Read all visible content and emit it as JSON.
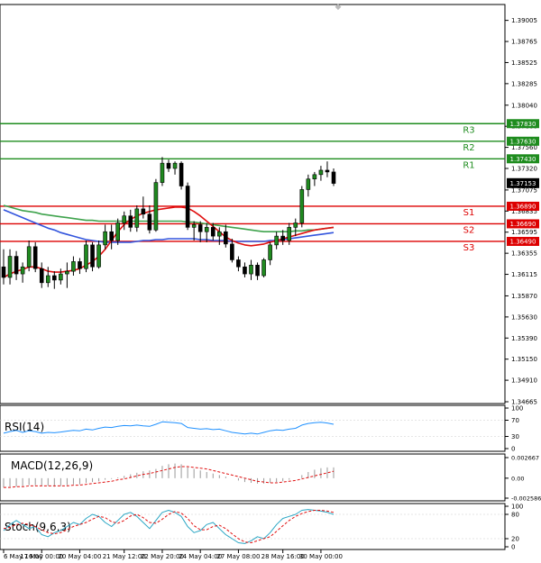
{
  "chart_data": {
    "type": "candlestick",
    "main": {
      "ylim": [
        1.34665,
        1.39155
      ],
      "price_axis_labels": [
        "1.39005",
        "1.38765",
        "1.38525",
        "1.38285",
        "1.38040",
        "1.37800",
        "1.37560",
        "1.37320",
        "1.37075",
        "1.36835",
        "1.36595",
        "1.36355",
        "1.36115",
        "1.35870",
        "1.35630",
        "1.35390",
        "1.35150",
        "1.34910",
        "1.34665"
      ],
      "levels": [
        {
          "name": "R3",
          "value": 1.3783,
          "label": "1.37830",
          "color": "#1e8c1e"
        },
        {
          "name": "R2",
          "value": 1.3763,
          "label": "1.37630",
          "color": "#1e8c1e"
        },
        {
          "name": "R1",
          "value": 1.3743,
          "label": "1.37430",
          "color": "#1e8c1e"
        },
        {
          "name": "S1",
          "value": 1.3689,
          "label": "1.36890",
          "color": "#dd0000"
        },
        {
          "name": "S2",
          "value": 1.3669,
          "label": "1.36690",
          "color": "#dd0000"
        },
        {
          "name": "S3",
          "value": 1.3649,
          "label": "1.36490",
          "color": "#dd0000"
        }
      ],
      "current_price": {
        "value": 1.37153,
        "label": "1.37153"
      },
      "candles": [
        [
          1.362,
          1.364,
          1.36,
          1.3608
        ],
        [
          1.3608,
          1.364,
          1.36,
          1.3632
        ],
        [
          1.3632,
          1.3638,
          1.3605,
          1.3612
        ],
        [
          1.3612,
          1.3625,
          1.3602,
          1.362
        ],
        [
          1.362,
          1.365,
          1.3615,
          1.3643
        ],
        [
          1.3643,
          1.3648,
          1.3614,
          1.3618
        ],
        [
          1.3618,
          1.3625,
          1.3596,
          1.3602
        ],
        [
          1.3602,
          1.362,
          1.3597,
          1.361
        ],
        [
          1.361,
          1.3615,
          1.3595,
          1.3605
        ],
        [
          1.3605,
          1.3618,
          1.36,
          1.3612
        ],
        [
          1.3612,
          1.3625,
          1.3596,
          1.3615
        ],
        [
          1.3615,
          1.3632,
          1.361,
          1.3626
        ],
        [
          1.3626,
          1.363,
          1.3612,
          1.3618
        ],
        [
          1.3618,
          1.365,
          1.3614,
          1.3645
        ],
        [
          1.3645,
          1.3648,
          1.3615,
          1.362
        ],
        [
          1.362,
          1.365,
          1.3618,
          1.3645
        ],
        [
          1.3645,
          1.3668,
          1.364,
          1.366
        ],
        [
          1.366,
          1.3668,
          1.364,
          1.365
        ],
        [
          1.365,
          1.3675,
          1.3645,
          1.367
        ],
        [
          1.367,
          1.3683,
          1.3662,
          1.3678
        ],
        [
          1.3678,
          1.3685,
          1.366,
          1.3665
        ],
        [
          1.3665,
          1.369,
          1.366,
          1.3686
        ],
        [
          1.3686,
          1.37,
          1.3675,
          1.368
        ],
        [
          1.368,
          1.369,
          1.3658,
          1.3662
        ],
        [
          1.3662,
          1.372,
          1.366,
          1.3716
        ],
        [
          1.3716,
          1.3745,
          1.3712,
          1.3738
        ],
        [
          1.3738,
          1.3742,
          1.3728,
          1.3732
        ],
        [
          1.3732,
          1.374,
          1.3725,
          1.3738
        ],
        [
          1.3738,
          1.374,
          1.3708,
          1.3712
        ],
        [
          1.3712,
          1.3716,
          1.3662,
          1.3665
        ],
        [
          1.3665,
          1.3672,
          1.365,
          1.3668
        ],
        [
          1.3668,
          1.3672,
          1.3648,
          1.366
        ],
        [
          1.366,
          1.367,
          1.3648,
          1.3665
        ],
        [
          1.3665,
          1.367,
          1.365,
          1.3655
        ],
        [
          1.3655,
          1.3665,
          1.3645,
          1.366
        ],
        [
          1.366,
          1.3668,
          1.3642,
          1.3646
        ],
        [
          1.3646,
          1.3652,
          1.3625,
          1.3628
        ],
        [
          1.3628,
          1.3632,
          1.3615,
          1.362
        ],
        [
          1.362,
          1.3625,
          1.3608,
          1.3612
        ],
        [
          1.3612,
          1.3628,
          1.3605,
          1.3622
        ],
        [
          1.3622,
          1.3625,
          1.3605,
          1.361
        ],
        [
          1.361,
          1.363,
          1.3608,
          1.3628
        ],
        [
          1.3628,
          1.3648,
          1.3622,
          1.3645
        ],
        [
          1.3645,
          1.366,
          1.364,
          1.3655
        ],
        [
          1.3655,
          1.3662,
          1.3645,
          1.365
        ],
        [
          1.365,
          1.367,
          1.3645,
          1.3665
        ],
        [
          1.3665,
          1.3675,
          1.3655,
          1.367
        ],
        [
          1.367,
          1.3712,
          1.3665,
          1.3708
        ],
        [
          1.3708,
          1.3725,
          1.37,
          1.372
        ],
        [
          1.372,
          1.3728,
          1.3712,
          1.3725
        ],
        [
          1.3725,
          1.3735,
          1.3718,
          1.373
        ],
        [
          1.373,
          1.374,
          1.3722,
          1.3728
        ],
        [
          1.3728,
          1.3732,
          1.3712,
          1.3715
        ]
      ],
      "ma_red": [
        1.3608,
        1.3612,
        1.3615,
        1.3617,
        1.362,
        1.362,
        1.3618,
        1.3615,
        1.3614,
        1.3614,
        1.3615,
        1.3616,
        1.3618,
        1.3622,
        1.3626,
        1.3632,
        1.364,
        1.365,
        1.366,
        1.3668,
        1.3674,
        1.3678,
        1.3681,
        1.3683,
        1.3685,
        1.3686,
        1.3687,
        1.3688,
        1.3688,
        1.3687,
        1.3683,
        1.3678,
        1.3672,
        1.3666,
        1.366,
        1.3654,
        1.365,
        1.3647,
        1.3645,
        1.3644,
        1.3645,
        1.3646,
        1.3648,
        1.365,
        1.3652,
        1.3654,
        1.3656,
        1.3658,
        1.366,
        1.3662,
        1.3663,
        1.3664,
        1.3665
      ],
      "ma_blue": [
        1.3685,
        1.3682,
        1.3679,
        1.3676,
        1.3673,
        1.367,
        1.3667,
        1.3664,
        1.3662,
        1.3659,
        1.3657,
        1.3655,
        1.3653,
        1.3651,
        1.365,
        1.3649,
        1.3648,
        1.3648,
        1.3648,
        1.3648,
        1.3648,
        1.3649,
        1.365,
        1.365,
        1.3651,
        1.3651,
        1.3652,
        1.3652,
        1.3652,
        1.3652,
        1.3652,
        1.3651,
        1.3651,
        1.365,
        1.365,
        1.365,
        1.3649,
        1.3649,
        1.3649,
        1.3649,
        1.3649,
        1.3649,
        1.365,
        1.365,
        1.3651,
        1.3652,
        1.3653,
        1.3654,
        1.3655,
        1.3656,
        1.3657,
        1.3658,
        1.3659
      ],
      "ma_green": [
        1.369,
        1.3688,
        1.3686,
        1.3684,
        1.3683,
        1.3682,
        1.368,
        1.3679,
        1.3678,
        1.3677,
        1.3676,
        1.3675,
        1.3674,
        1.3673,
        1.3673,
        1.3672,
        1.3672,
        1.3672,
        1.3672,
        1.3672,
        1.3672,
        1.3672,
        1.3672,
        1.3672,
        1.3672,
        1.3672,
        1.3672,
        1.3672,
        1.3672,
        1.3671,
        1.3671,
        1.367,
        1.3669,
        1.3668,
        1.3667,
        1.3666,
        1.3665,
        1.3664,
        1.3663,
        1.3662,
        1.3661,
        1.366,
        1.366,
        1.366,
        1.366,
        1.366,
        1.3661,
        1.3661,
        1.3662,
        1.3662,
        1.3663,
        1.3664,
        1.3665
      ]
    },
    "rsi": {
      "label": "RSI(14)",
      "ylim": [
        0,
        100
      ],
      "axis_labels": [
        "100",
        "70",
        "30",
        "0"
      ],
      "axis_values": [
        100,
        70,
        30,
        0
      ],
      "values": [
        38,
        42,
        45,
        40,
        44,
        42,
        38,
        40,
        39,
        41,
        43,
        45,
        44,
        48,
        46,
        50,
        53,
        52,
        55,
        57,
        56,
        58,
        56,
        55,
        60,
        66,
        65,
        64,
        62,
        52,
        50,
        48,
        49,
        47,
        48,
        44,
        40,
        38,
        36,
        38,
        36,
        40,
        44,
        46,
        45,
        48,
        50,
        58,
        62,
        64,
        65,
        63,
        60
      ]
    },
    "macd": {
      "label": "MACD(12,26,9)",
      "ylim": [
        -0.002586,
        0.002667
      ],
      "axis_labels": [
        "0.002667",
        "0.00",
        "-0.002586"
      ],
      "axis_values": [
        0.002667,
        0,
        -0.002586
      ],
      "hist": [
        -0.0012,
        -0.0011,
        -0.0011,
        -0.001,
        -0.0009,
        -0.0009,
        -0.001,
        -0.001,
        -0.0011,
        -0.001,
        -0.0009,
        -0.0008,
        -0.0008,
        -0.0006,
        -0.0005,
        -0.0004,
        -0.0002,
        -0.0001,
        0.0001,
        0.0003,
        0.0005,
        0.0007,
        0.0009,
        0.001,
        0.0012,
        0.0016,
        0.0018,
        0.0019,
        0.0018,
        0.0014,
        0.0012,
        0.001,
        0.0008,
        0.0006,
        0.0004,
        0.0002,
        0.0,
        -0.0003,
        -0.0005,
        -0.0006,
        -0.0007,
        -0.0007,
        -0.0006,
        -0.0005,
        -0.0004,
        -0.0002,
        0.0,
        0.0004,
        0.0008,
        0.0011,
        0.0013,
        0.0014,
        0.0014
      ],
      "signal": [
        -0.0012,
        -0.0012,
        -0.0011,
        -0.0011,
        -0.001,
        -0.001,
        -0.001,
        -0.001,
        -0.001,
        -0.001,
        -0.001,
        -0.0009,
        -0.0009,
        -0.0008,
        -0.0007,
        -0.0006,
        -0.0005,
        -0.0004,
        -0.0002,
        -0.0001,
        0.0001,
        0.0003,
        0.0005,
        0.0006,
        0.0008,
        0.001,
        0.0012,
        0.0014,
        0.0015,
        0.0015,
        0.0014,
        0.0013,
        0.0012,
        0.001,
        0.0008,
        0.0006,
        0.0004,
        0.0002,
        0.0,
        -0.0002,
        -0.0004,
        -0.0005,
        -0.0006,
        -0.0006,
        -0.0005,
        -0.0004,
        -0.0003,
        -0.0001,
        0.0001,
        0.0003,
        0.0005,
        0.0007,
        0.0009
      ]
    },
    "stoch": {
      "label": "Stoch(9,6,3)",
      "ylim": [
        0,
        100
      ],
      "axis_labels": [
        "100",
        "80",
        "20",
        "0"
      ],
      "axis_values": [
        100,
        80,
        20,
        0
      ],
      "k": [
        40,
        55,
        65,
        55,
        45,
        50,
        30,
        25,
        35,
        40,
        50,
        60,
        55,
        70,
        80,
        75,
        60,
        50,
        65,
        80,
        85,
        75,
        60,
        45,
        65,
        85,
        90,
        85,
        75,
        50,
        35,
        40,
        55,
        60,
        45,
        30,
        20,
        10,
        8,
        15,
        25,
        20,
        35,
        55,
        70,
        75,
        80,
        90,
        92,
        90,
        88,
        85,
        80
      ],
      "d": [
        45,
        48,
        55,
        58,
        55,
        50,
        42,
        35,
        32,
        35,
        42,
        50,
        55,
        60,
        68,
        75,
        72,
        62,
        58,
        65,
        76,
        80,
        72,
        60,
        58,
        68,
        80,
        87,
        83,
        70,
        52,
        42,
        42,
        50,
        53,
        45,
        32,
        20,
        12,
        10,
        15,
        20,
        25,
        38,
        52,
        65,
        75,
        82,
        87,
        90,
        90,
        88,
        85
      ]
    },
    "x_tick_labels": [
      "6 May 16:00",
      "17 May 00:00",
      "20 May 04:00",
      "21 May 12:00",
      "22 May 20:00",
      "24 May 04:00",
      "27 May 08:00",
      "28 May 16:00",
      "30 May 00:00"
    ],
    "x_tick_index": [
      0,
      6,
      12,
      19,
      25,
      31,
      37,
      44,
      50
    ]
  }
}
